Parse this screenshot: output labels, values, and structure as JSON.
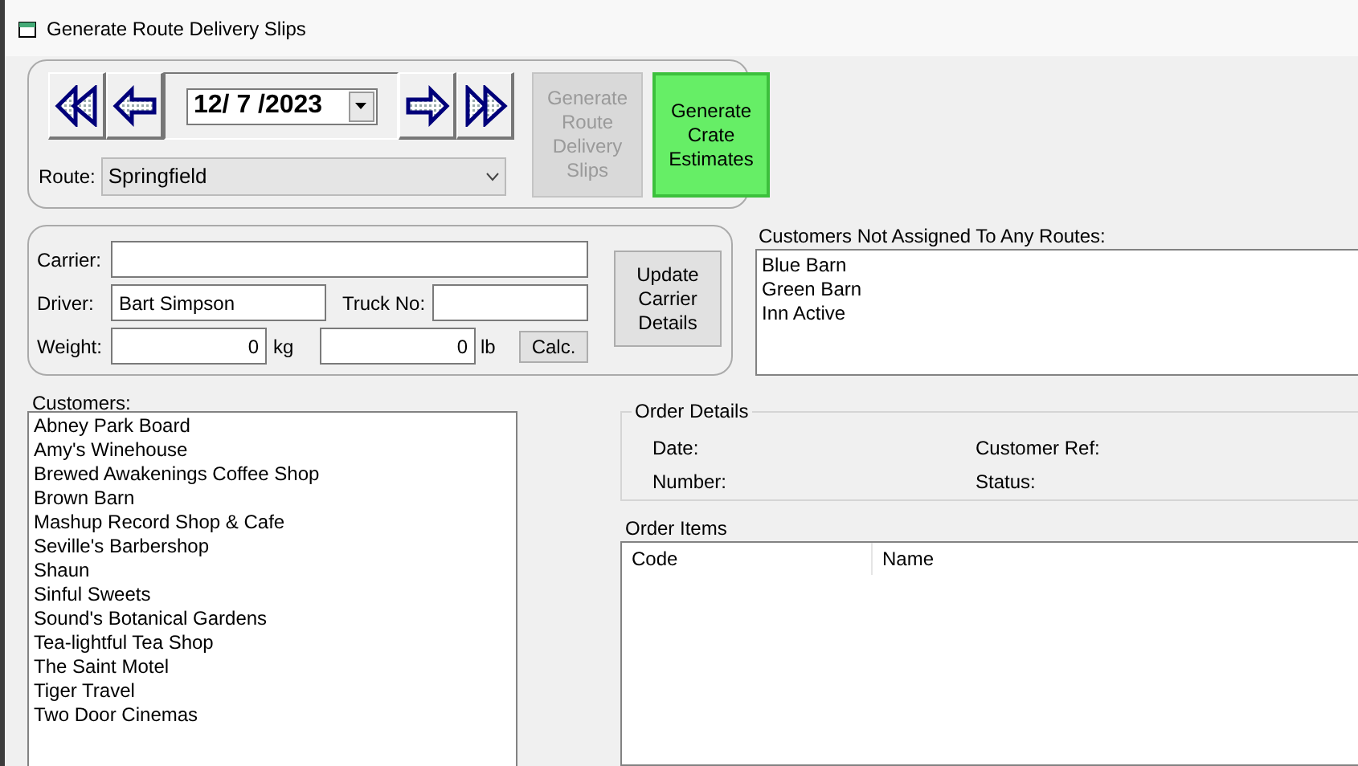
{
  "window": {
    "title": "Generate Route Delivery Slips"
  },
  "date_picker": {
    "value": "12/ 7 /2023"
  },
  "route": {
    "label": "Route:",
    "value": "Springfield"
  },
  "action_buttons": [
    {
      "label": "Generate Route Delivery Slips",
      "disabled": true
    },
    {
      "label": "Generate Crate Estimates",
      "disabled": false
    }
  ],
  "carrier": {
    "carrier_label": "Carrier:",
    "driver_label": "Driver:",
    "driver_value": "Bart Simpson",
    "truck_label": "Truck No:",
    "weight_label": "Weight:",
    "weight_kg": "0",
    "kg_unit": "kg",
    "weight_lb": "0",
    "lb_unit": "lb",
    "calc_button": "Calc.",
    "update_button": "Update Carrier Details"
  },
  "unassigned": {
    "label": "Customers Not Assigned To Any Routes:",
    "items": [
      "Blue Barn",
      "Green Barn",
      "Inn Active"
    ]
  },
  "customers": {
    "label": "Customers:",
    "items": [
      "Abney Park Board",
      "Amy's Winehouse",
      "Brewed Awakenings Coffee Shop",
      "Brown Barn",
      "Mashup Record Shop & Cafe",
      "Seville's Barbershop",
      "Shaun",
      "Sinful Sweets",
      "Sound's Botanical Gardens",
      "Tea-lightful Tea Shop",
      "The Saint Motel",
      "Tiger Travel",
      "Two Door Cinemas"
    ]
  },
  "order_details": {
    "title": "Order Details",
    "date_label": "Date:",
    "number_label": "Number:",
    "customer_ref_label": "Customer Ref:",
    "status_label": "Status:"
  },
  "order_items": {
    "label": "Order Items",
    "columns": [
      "Code",
      "Name"
    ]
  }
}
